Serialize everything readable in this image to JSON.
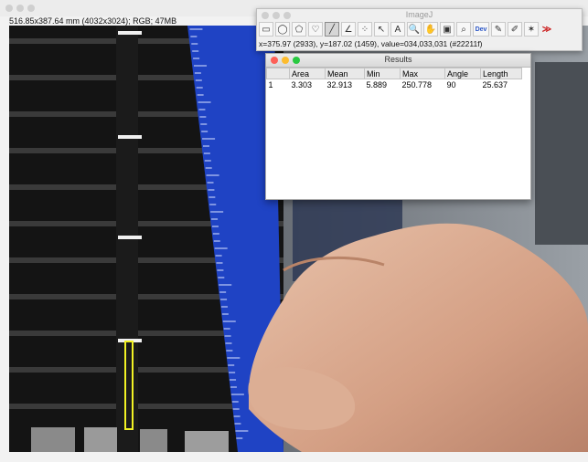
{
  "image_window": {
    "info": "516.85x387.64 mm (4032x3024); RGB; 47MB"
  },
  "toolbar": {
    "title": "ImageJ",
    "tools": [
      {
        "name": "rectangle-tool",
        "glyph": "▭"
      },
      {
        "name": "oval-tool",
        "glyph": "◯"
      },
      {
        "name": "polygon-tool",
        "glyph": "⬠"
      },
      {
        "name": "freehand-tool",
        "glyph": "♡"
      },
      {
        "name": "line-tool",
        "glyph": "╱",
        "active": true
      },
      {
        "name": "angle-tool",
        "glyph": "∠"
      },
      {
        "name": "point-tool",
        "glyph": "⁘"
      },
      {
        "name": "wand-tool",
        "glyph": "↖"
      },
      {
        "name": "text-tool",
        "glyph": "A"
      },
      {
        "name": "magnifier-tool",
        "glyph": "🔍"
      },
      {
        "name": "scroll-tool",
        "glyph": "✋"
      },
      {
        "name": "color-picker-tool",
        "glyph": "▣"
      },
      {
        "name": "search-tool",
        "glyph": "⌕"
      },
      {
        "name": "dev-tool",
        "glyph": "Dev"
      },
      {
        "name": "pencil-tool",
        "glyph": "✎"
      },
      {
        "name": "brush-tool",
        "glyph": "✐"
      },
      {
        "name": "flood-fill-tool",
        "glyph": "✶"
      },
      {
        "name": "more-tools",
        "glyph": "≫"
      }
    ],
    "status": "x=375.97 (2933), y=187.02 (1459), value=034,033,031 (#22211f)"
  },
  "results": {
    "title": "Results",
    "columns": [
      "",
      "Area",
      "Mean",
      "Min",
      "Max",
      "Angle",
      "Length"
    ],
    "rows": [
      [
        "1",
        "3.303",
        "32.913",
        "5.889",
        "250.778",
        "90",
        "25.637"
      ]
    ]
  },
  "colors": {
    "ruler_blue": "#1f43c4",
    "measurement_line": "#f2f224",
    "close": "#fd5f57",
    "minimize": "#fdbc2e",
    "zoom": "#28c940"
  }
}
